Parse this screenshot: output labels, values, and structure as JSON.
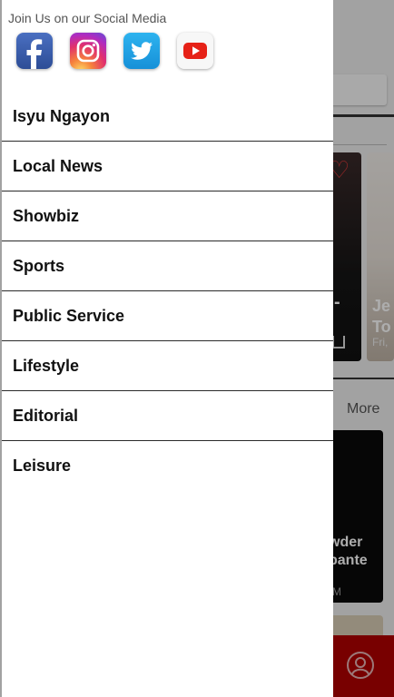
{
  "background": {
    "more_label": "More",
    "card_title_fragment": "Je\nTo",
    "card_date_fragment": "Fri,",
    "card_dash": "-",
    "card3_title_fragment": "wder\nbante",
    "card3_time_fragment": "M"
  },
  "drawer": {
    "social_heading": "Join Us on our Social Media",
    "social_links": [
      {
        "name": "Facebook",
        "icon": "facebook-icon"
      },
      {
        "name": "Instagram",
        "icon": "instagram-icon"
      },
      {
        "name": "Twitter",
        "icon": "twitter-icon"
      },
      {
        "name": "YouTube",
        "icon": "youtube-icon"
      }
    ],
    "menu_items": [
      {
        "label": "Isyu Ngayon"
      },
      {
        "label": "Local News"
      },
      {
        "label": "Showbiz"
      },
      {
        "label": "Sports"
      },
      {
        "label": "Public Service"
      },
      {
        "label": "Lifestyle"
      },
      {
        "label": "Editorial"
      },
      {
        "label": "Leisure"
      }
    ]
  },
  "colors": {
    "bottom_bar": "#b10000",
    "heart": "#e03a3a"
  }
}
